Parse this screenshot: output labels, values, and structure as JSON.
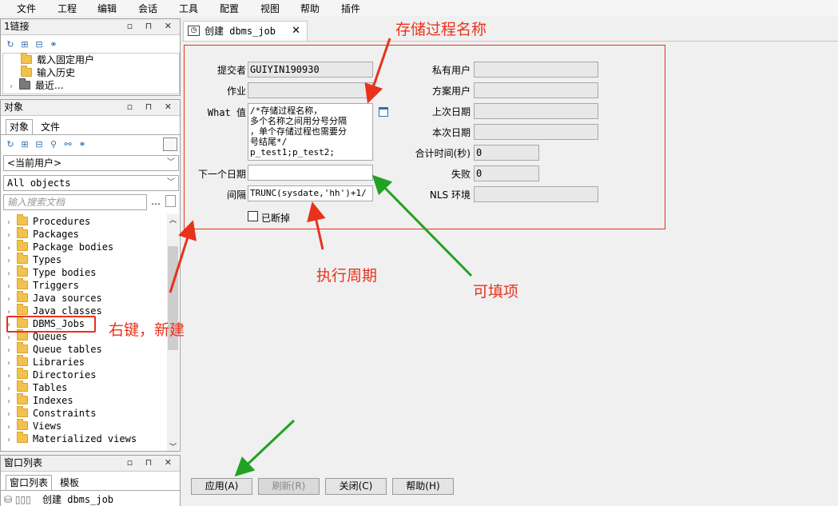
{
  "menu": [
    "文件",
    "工程",
    "编辑",
    "会话",
    "工具",
    "配置",
    "视图",
    "帮助",
    "插件"
  ],
  "links_panel": {
    "title": "1链接",
    "items": [
      "载入固定用户",
      "输入历史",
      "最近..."
    ]
  },
  "objects_panel": {
    "title": "对象",
    "tabs": [
      "对象",
      "文件"
    ],
    "owner": "<当前用户>",
    "filter": "All objects",
    "search_placeholder": "输入搜索文档",
    "tree": [
      "Procedures",
      "Packages",
      "Package bodies",
      "Types",
      "Type bodies",
      "Triggers",
      "Java sources",
      "Java classes",
      "DBMS_Jobs",
      "Queues",
      "Queue tables",
      "Libraries",
      "Directories",
      "Tables",
      "Indexes",
      "Constraints",
      "Views",
      "Materialized views"
    ],
    "selected": "DBMS_Jobs"
  },
  "window_panel": {
    "title": "窗口列表",
    "tabs": [
      "窗口列表",
      "模板"
    ],
    "items": [
      "创建 dbms_job"
    ]
  },
  "tab_title": "创建 dbms_job",
  "form": {
    "submitter_label": "提交者",
    "submitter_value": "GUIYIN190930",
    "job_label": "作业",
    "job_value": "",
    "what_label": "What 值",
    "what_value": "/*存储过程名称，\n多个名称之间用分号分隔\n，单个存储过程也需要分\n号结尾*/\np_test1;p_test2;",
    "next_date_label": "下一个日期",
    "next_date_value": "",
    "interval_label": "间隔",
    "interval_value": "TRUNC(sysdate,'hh')+1/",
    "broken_label": "已断掉",
    "priv_user_label": "私有用户",
    "schema_user_label": "方案用户",
    "last_date_label": "上次日期",
    "this_date_label": "本次日期",
    "total_time_label": "合计时间(秒)",
    "total_time_value": "0",
    "failures_label": "失败",
    "failures_value": "0",
    "nls_label": "NLS 环境"
  },
  "buttons": {
    "apply": "应用(A)",
    "refresh": "刷新(R)",
    "close": "关闭(C)",
    "help": "帮助(H)"
  },
  "annotations": {
    "proc_name": "存储过程名称",
    "interval": "执行周期",
    "fillable": "可填项",
    "right_click": "右键，新建"
  },
  "colors": {
    "annotation_red": "#e8321c",
    "arrow_green": "#22a122",
    "selection_box": "#e8321c"
  }
}
